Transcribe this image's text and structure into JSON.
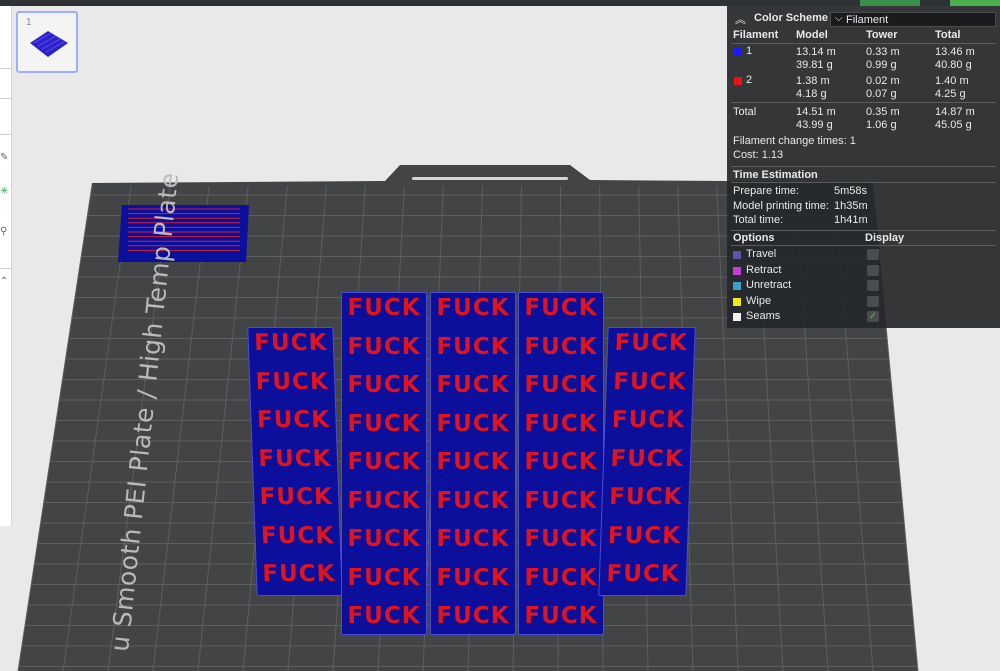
{
  "plate": {
    "label": "u Smooth PEI Plate / High Temp Plate",
    "object_text": "FUCK",
    "thumbnail_number": "1"
  },
  "colors": {
    "filament_1": "#0c0e9c",
    "filament_2": "#e0141c",
    "bed": "#424446",
    "panel_bg": "#26282a"
  },
  "color_scheme": {
    "title": "Color Scheme",
    "selected": "Filament",
    "headers": [
      "Filament",
      "Model",
      "Tower",
      "Total"
    ],
    "rows": [
      {
        "name": "1",
        "color": "#1a1aff",
        "model_len": "13.14 m",
        "model_wt": "39.81 g",
        "tower_len": "0.33 m",
        "tower_wt": "0.99 g",
        "total_len": "13.46 m",
        "total_wt": "40.80 g"
      },
      {
        "name": "2",
        "color": "#e8141c",
        "model_len": "1.38 m",
        "model_wt": "4.18 g",
        "tower_len": "0.02 m",
        "tower_wt": "0.07 g",
        "total_len": "1.40 m",
        "total_wt": "4.25 g"
      }
    ],
    "total": {
      "label": "Total",
      "model_len": "14.51 m",
      "model_wt": "43.99 g",
      "tower_len": "0.35 m",
      "tower_wt": "1.06 g",
      "total_len": "14.87 m",
      "total_wt": "45.05 g"
    },
    "filament_change": "Filament change times:  1",
    "cost": "Cost:  1.13"
  },
  "time_estimation": {
    "title": "Time Estimation",
    "prepare_label": "Prepare time:",
    "prepare_value": "5m58s",
    "model_label": "Model printing time:",
    "model_value": "1h35m",
    "total_label": "Total time:",
    "total_value": "1h41m"
  },
  "options": {
    "title": "Options",
    "display_title": "Display",
    "items": [
      {
        "label": "Travel",
        "color": "#5a56a8",
        "checked": false
      },
      {
        "label": "Retract",
        "color": "#c43cd8",
        "checked": false
      },
      {
        "label": "Unretract",
        "color": "#3aa0c8",
        "checked": false
      },
      {
        "label": "Wipe",
        "color": "#f2e81a",
        "checked": false
      },
      {
        "label": "Seams",
        "color": "#efefef",
        "checked": true
      }
    ]
  }
}
